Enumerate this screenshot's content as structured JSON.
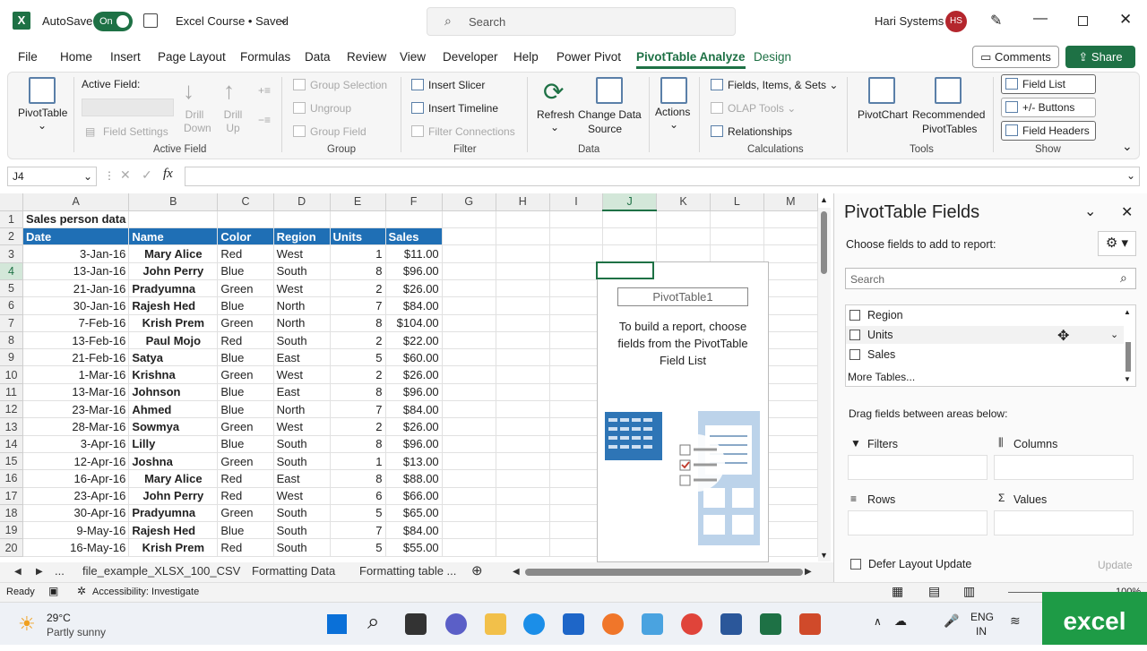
{
  "titlebar": {
    "autosave_label": "AutoSave",
    "autosave_state": "On",
    "doc_title": "Excel Course • Saved",
    "search_placeholder": "Search",
    "user_name": "Hari Systems",
    "user_initials": "HS"
  },
  "tabs": [
    "File",
    "Home",
    "Insert",
    "Page Layout",
    "Formulas",
    "Data",
    "Review",
    "View",
    "Developer",
    "Help",
    "Power Pivot",
    "PivotTable Analyze",
    "Design"
  ],
  "header_buttons": {
    "comments": "Comments",
    "share": "Share"
  },
  "ribbon": {
    "pivottable": "PivotTable",
    "active_field_label": "Active Field:",
    "drill_down": "Drill Down",
    "drill_up": "Drill Up",
    "field_settings": "Field Settings",
    "group_active_field": "Active Field",
    "group_selection": "Group Selection",
    "ungroup": "Ungroup",
    "group_field": "Group Field",
    "group_group": "Group",
    "insert_slicer": "Insert Slicer",
    "insert_timeline": "Insert Timeline",
    "filter_connections": "Filter Connections",
    "group_filter": "Filter",
    "refresh": "Refresh",
    "change_source_1": "Change Data",
    "change_source_2": "Source",
    "group_data": "Data",
    "actions": "Actions",
    "fields_items_sets": "Fields, Items, & Sets",
    "olap_tools": "OLAP Tools",
    "relationships": "Relationships",
    "group_calculations": "Calculations",
    "pivotchart": "PivotChart",
    "recommended_1": "Recommended",
    "recommended_2": "PivotTables",
    "group_tools": "Tools",
    "field_list": "Field List",
    "plus_minus": "+/- Buttons",
    "field_headers": "Field Headers",
    "group_show": "Show"
  },
  "formula_bar": {
    "name_box": "J4",
    "fx": "fx",
    "content": ""
  },
  "sheet": {
    "columns": [
      "A",
      "B",
      "C",
      "D",
      "E",
      "F",
      "G",
      "H",
      "I",
      "J",
      "K",
      "L",
      "M"
    ],
    "title": "Sales person data",
    "headers": [
      "Date",
      "Name",
      "Color",
      "Region",
      "Units",
      "Sales"
    ],
    "rows": [
      [
        "3-Jan-16",
        "Mary Alice",
        "Red",
        "West",
        "1",
        "$11.00"
      ],
      [
        "13-Jan-16",
        "John Perry",
        "Blue",
        "South",
        "8",
        "$96.00"
      ],
      [
        "21-Jan-16",
        "Pradyumna",
        "Green",
        "West",
        "2",
        "$26.00"
      ],
      [
        "30-Jan-16",
        "Rajesh Hed",
        "Blue",
        "North",
        "7",
        "$84.00"
      ],
      [
        "7-Feb-16",
        "Krish Prem",
        "Green",
        "North",
        "8",
        "$104.00"
      ],
      [
        "13-Feb-16",
        "Paul Mojo",
        "Red",
        "South",
        "2",
        "$22.00"
      ],
      [
        "21-Feb-16",
        "Satya",
        "Blue",
        "East",
        "5",
        "$60.00"
      ],
      [
        "1-Mar-16",
        "Krishna",
        "Green",
        "West",
        "2",
        "$26.00"
      ],
      [
        "13-Mar-16",
        "Johnson",
        "Blue",
        "East",
        "8",
        "$96.00"
      ],
      [
        "23-Mar-16",
        "Ahmed",
        "Blue",
        "North",
        "7",
        "$84.00"
      ],
      [
        "28-Mar-16",
        "Sowmya",
        "Green",
        "West",
        "2",
        "$26.00"
      ],
      [
        "3-Apr-16",
        "Lilly",
        "Blue",
        "South",
        "8",
        "$96.00"
      ],
      [
        "12-Apr-16",
        "Joshna",
        "Green",
        "South",
        "1",
        "$13.00"
      ],
      [
        "16-Apr-16",
        "Mary Alice",
        "Red",
        "East",
        "8",
        "$88.00"
      ],
      [
        "23-Apr-16",
        "John Perry",
        "Red",
        "West",
        "6",
        "$66.00"
      ],
      [
        "30-Apr-16",
        "Pradyumna",
        "Green",
        "South",
        "5",
        "$65.00"
      ],
      [
        "9-May-16",
        "Rajesh Hed",
        "Blue",
        "South",
        "7",
        "$84.00"
      ],
      [
        "16-May-16",
        "Krish Prem",
        "Red",
        "South",
        "5",
        "$55.00"
      ]
    ]
  },
  "pivot_placeholder": {
    "name": "PivotTable1",
    "message": "To build a report, choose fields from the PivotTable Field List"
  },
  "sheet_tabs": [
    "...",
    "file_example_XLSX_100_CSV",
    "Formatting Data",
    "Formatting table ..."
  ],
  "status": {
    "ready": "Ready",
    "accessibility": "Accessibility: Investigate",
    "zoom": "100%"
  },
  "pane": {
    "title": "PivotTable Fields",
    "choose": "Choose fields to add to report:",
    "search_placeholder": "Search",
    "fields": [
      "Region",
      "Units",
      "Sales"
    ],
    "more_tables": "More Tables...",
    "drag_hint": "Drag fields between areas below:",
    "areas": [
      "Filters",
      "Columns",
      "Rows",
      "Values"
    ],
    "defer": "Defer Layout Update",
    "update": "Update"
  },
  "taskbar": {
    "temp": "29°C",
    "weather": "Partly sunny",
    "lang_1": "ENG",
    "lang_2": "IN",
    "badge": "excel"
  }
}
